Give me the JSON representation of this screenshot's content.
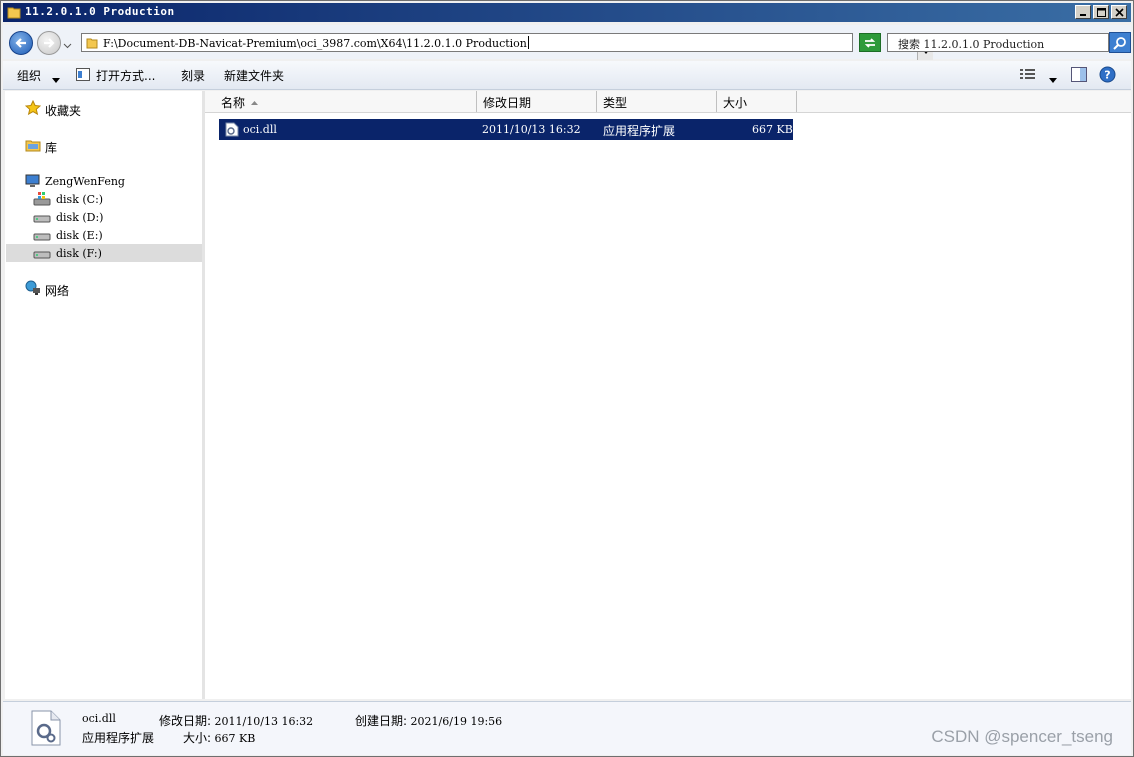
{
  "window": {
    "title": "11.2.0.1.0 Production"
  },
  "address_bar": {
    "path": "F:\\Document-DB-Navicat-Premium\\oci_3987.com\\X64\\11.2.0.1.0 Production",
    "search_placeholder": "搜索 11.2.0.1.0 Production"
  },
  "toolbar": {
    "organize": "组织",
    "open_with": "打开方式...",
    "burn": "刻录",
    "new_folder": "新建文件夹"
  },
  "nav": {
    "favorites": "收藏夹",
    "libraries": "库",
    "computer": "ZengWenFeng",
    "drives": [
      {
        "label": "disk (C:)"
      },
      {
        "label": "disk (D:)"
      },
      {
        "label": "disk (E:)"
      },
      {
        "label": "disk (F:)"
      }
    ],
    "network": "网络"
  },
  "columns": {
    "name": "名称",
    "modified": "修改日期",
    "type": "类型",
    "size": "大小"
  },
  "files": [
    {
      "name": "oci.dll",
      "modified": "2011/10/13 16:32",
      "type": "应用程序扩展",
      "size": "667 KB"
    }
  ],
  "details": {
    "filename": "oci.dll",
    "type": "应用程序扩展",
    "modified_label": "修改日期:",
    "modified_value": "2011/10/13 16:32",
    "created_label": "创建日期:",
    "created_value": "2021/6/19 19:56",
    "size_label": "大小:",
    "size_value": "667 KB"
  },
  "watermark": "CSDN @spencer_tseng",
  "colors": {
    "title_bar": "#0a246a",
    "selection": "#0a246a",
    "accent_blue": "#3d7fd0"
  }
}
